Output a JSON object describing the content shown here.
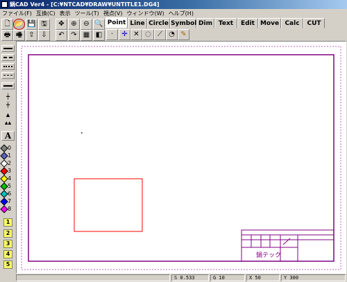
{
  "window": {
    "title": "鍋CAD Ver4 - [C:¥NTCAD¥DRAW¥UNTITLE1.DG4]"
  },
  "menu": [
    "ファイル(F)",
    "互換(C)",
    "表示",
    "ツール(T)",
    "視点(V)",
    "ウィンドウ(W)",
    "ヘルプ(H)"
  ],
  "tabs": [
    "Point",
    "Line",
    "Circle",
    "Symbol",
    "Dim",
    "Text",
    "Edit",
    "Move",
    "Calc",
    "CUT"
  ],
  "active_tab": "Point",
  "toolbar_icons": [
    "new-icon",
    "open-icon",
    "save-icon",
    "save-as-icon",
    "move-view-icon",
    "zoom-in-icon",
    "zoom-out-icon",
    "zoom-fit-icon",
    "print-icon",
    "print-preview-icon",
    "export-icon",
    "import-icon",
    "undo-icon",
    "redo-icon",
    "grid-icon",
    "frame-icon"
  ],
  "point_tools": [
    "dot-icon",
    "cross-point-icon",
    "intersection-icon",
    "circle-point-icon",
    "divide-point-icon",
    "tangent-point-icon",
    "eraser-point-icon"
  ],
  "line_types": [
    "solid",
    "dashed",
    "dotted",
    "dash-dot",
    "thick"
  ],
  "text_tool_label": "A",
  "pens": [
    "0",
    "1",
    "2",
    "3",
    "4",
    "5",
    "6",
    "7",
    "8"
  ],
  "pen_colors": [
    "#808080",
    "#6060c0",
    "#ffffff",
    "#ff0000",
    "#ffff00",
    "#00c000",
    "#00c0c0",
    "#0000ff",
    "#ff00ff"
  ],
  "layers": [
    "1",
    "2",
    "3",
    "4",
    "5"
  ],
  "title_block_text": "鍋テック",
  "status": {
    "s": "S 0.533",
    "g": "G 10",
    "x": "X 50",
    "y": "Y 300"
  },
  "colors": {
    "frame": "#800080",
    "rect": "#ff0000",
    "title_bar": "#0a246a"
  }
}
